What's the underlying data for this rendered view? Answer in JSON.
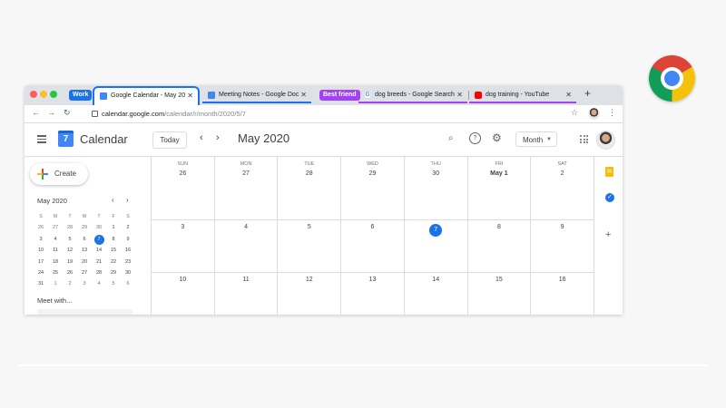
{
  "browser": {
    "tab_groups": [
      {
        "label": "Work",
        "color": "#1a73e8"
      },
      {
        "label": "Best friend",
        "color": "#a142f4"
      }
    ],
    "tabs": [
      {
        "title": "Google Calendar - May 2020",
        "favicon": "google-calendar-icon",
        "active": true
      },
      {
        "title": "Meeting Notes - Google Docs",
        "favicon": "google-docs-icon"
      },
      {
        "title": "dog breeds - Google Search",
        "favicon": "google-icon"
      },
      {
        "title": "dog training - YouTube",
        "favicon": "youtube-icon"
      }
    ],
    "new_tab_symbol": "+",
    "url_host": "calendar.google.com",
    "url_path": "/calendar/r/month/2020/5/7"
  },
  "calendar": {
    "app_name": "Calendar",
    "logo_day": "7",
    "today_label": "Today",
    "month_title": "May 2020",
    "view_label": "Month",
    "create_label": "Create",
    "mini": {
      "title": "May 2020",
      "weekday_heads": [
        "S",
        "M",
        "T",
        "W",
        "T",
        "F",
        "S"
      ],
      "weeks": [
        [
          "26",
          "27",
          "28",
          "29",
          "30",
          "1",
          "2"
        ],
        [
          "3",
          "4",
          "5",
          "6",
          "7",
          "8",
          "9"
        ],
        [
          "10",
          "11",
          "12",
          "13",
          "14",
          "15",
          "16"
        ],
        [
          "17",
          "18",
          "19",
          "20",
          "21",
          "22",
          "23"
        ],
        [
          "24",
          "25",
          "26",
          "27",
          "28",
          "29",
          "30"
        ],
        [
          "31",
          "1",
          "2",
          "3",
          "4",
          "5",
          "6"
        ]
      ],
      "today": "7"
    },
    "meet_with": "Meet with...",
    "weekdays": [
      "SUN",
      "MON",
      "TUE",
      "WED",
      "THU",
      "FRI",
      "SAT"
    ],
    "weeks": [
      [
        "26",
        "27",
        "28",
        "29",
        "30",
        "May 1",
        "2"
      ],
      [
        "3",
        "4",
        "5",
        "6",
        "7",
        "8",
        "9"
      ],
      [
        "10",
        "11",
        "12",
        "13",
        "14",
        "15",
        "16"
      ]
    ],
    "today": "7",
    "accent_color": "#1a73e8"
  }
}
